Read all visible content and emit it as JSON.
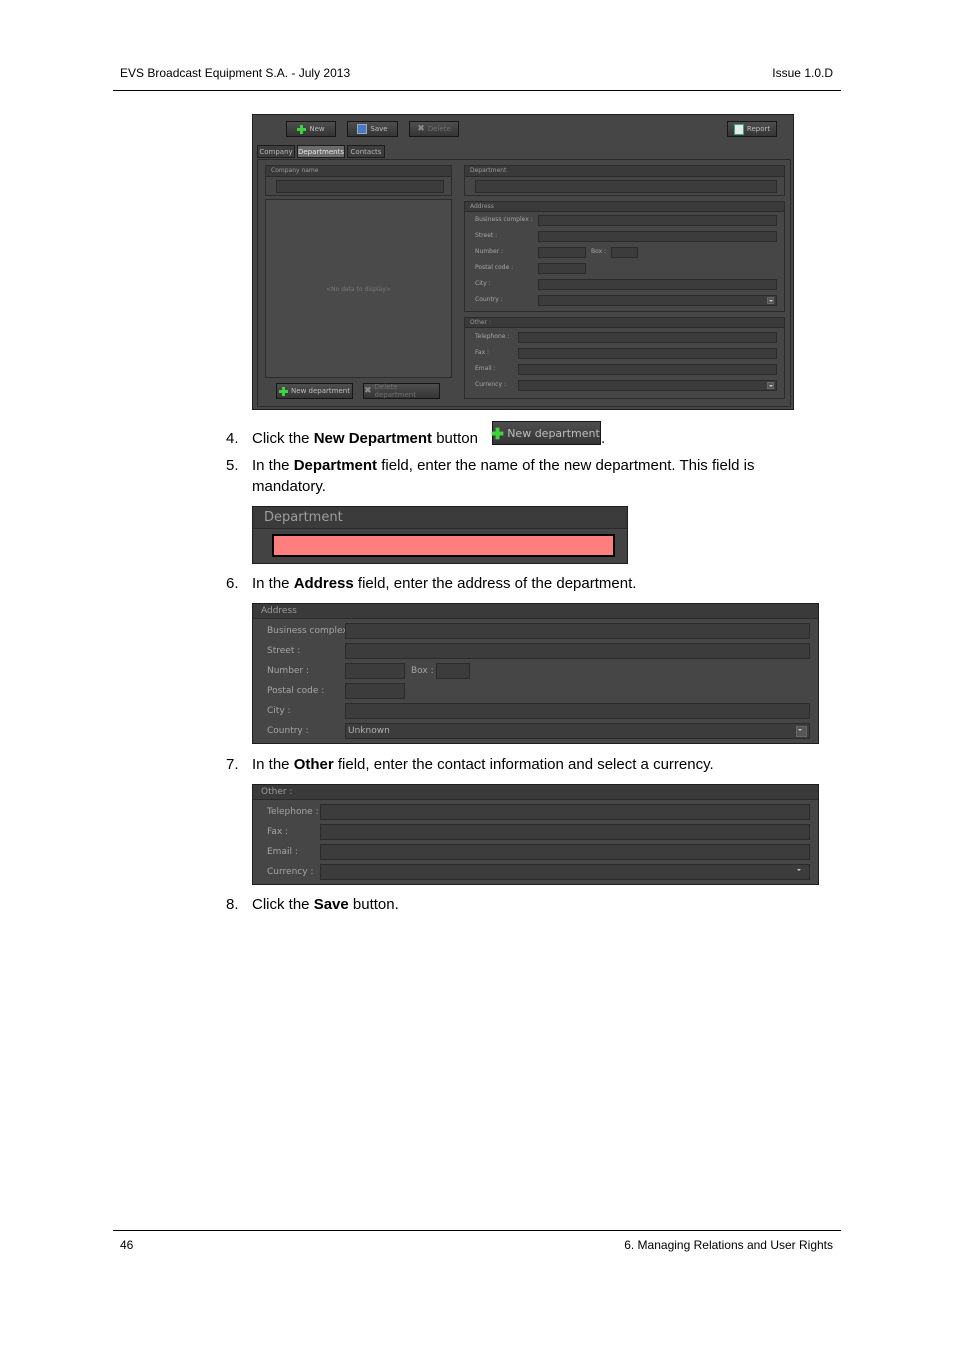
{
  "header": {
    "left": "EVS Broadcast Equipment S.A.  - July 2013",
    "right": "Issue 1.0.D"
  },
  "footer": {
    "page_number": "46",
    "chapter": "6. Managing Relations and User Rights"
  },
  "app": {
    "toolbar": {
      "new": "New",
      "save": "Save",
      "delete": "Delete",
      "report": "Report"
    },
    "tabs": [
      "Company",
      "Departments",
      "Contacts"
    ],
    "company_name_label": "Company name",
    "empty_list": "<No data to display>",
    "new_department": "New department",
    "delete_department": "Delete department",
    "department_label": "Department",
    "address_title": "Address",
    "address_labels": {
      "business_complex": "Business complex :",
      "street": "Street :",
      "number": "Number :",
      "box": "Box :",
      "postal_code": "Postal code :",
      "city": "City :",
      "country": "Country :"
    },
    "other_title": "Other :",
    "other_labels": {
      "telephone": "Telephone :",
      "fax": "Fax :",
      "email": "Email :",
      "currency": "Currency :"
    }
  },
  "steps": [
    {
      "num": "4.",
      "pre": "Click the ",
      "bold": "New Department",
      "post": " button"
    },
    {
      "num": "5.",
      "pre": "In the ",
      "bold": "Department",
      "post": " field, enter the name of the new department. This field is mandatory."
    },
    {
      "num": "6.",
      "pre": "In the ",
      "bold": "Address",
      "post": " field, enter the address of the department."
    },
    {
      "num": "7.",
      "pre": "In the ",
      "bold": "Other",
      "post": " field, enter the contact information and select a currency."
    },
    {
      "num": "8.",
      "pre": "Click the ",
      "bold": "Save",
      "post": " button."
    }
  ],
  "inline_button_label": "New department",
  "step4_trailing": ".",
  "department_panel": {
    "title": "Department",
    "field_color": "#ff7f7f"
  },
  "address_panel": {
    "title": "Address",
    "labels": {
      "business_complex": "Business complex :",
      "street": "Street :",
      "number": "Number :",
      "box": "Box :",
      "postal_code": "Postal code :",
      "city": "City :",
      "country": "Country :"
    },
    "country_value": "Unknown"
  },
  "other_panel": {
    "title": "Other :",
    "labels": {
      "telephone": "Telephone :",
      "fax": "Fax :",
      "email": "Email :",
      "currency": "Currency :"
    }
  }
}
